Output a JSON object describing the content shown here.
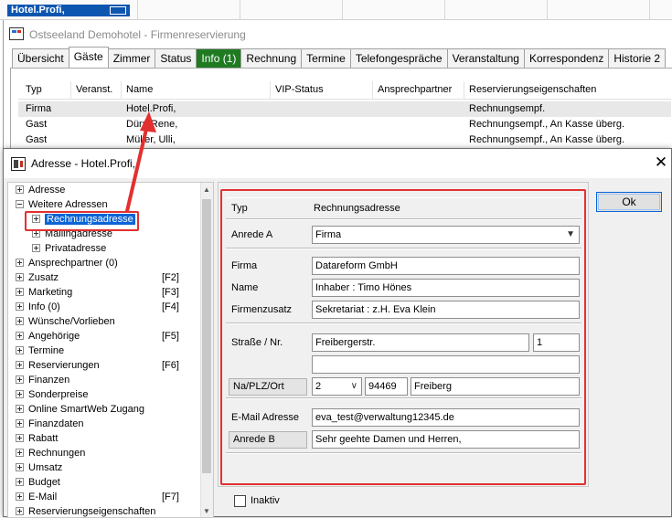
{
  "top_strip": {
    "cell_text": "Hotel.Profi,"
  },
  "back_window": {
    "title": "Ostseeland Demohotel - Firmenreservierung",
    "tabs": [
      "Übersicht",
      "Gäste",
      "Zimmer",
      "Status",
      "Info (1)",
      "Rechnung",
      "Termine",
      "Telefongespräche",
      "Veranstaltung",
      "Korrespondenz",
      "Historie 2"
    ],
    "active_tab": "Gäste",
    "columns": [
      "Typ",
      "Veranst.",
      "Name",
      "VIP-Status",
      "Ansprechpartner",
      "Reservierungseigenschaften"
    ],
    "rows": [
      {
        "typ": "Firma",
        "name": "Hotel.Profi,",
        "eigenschaften": "Rechnungsempf."
      },
      {
        "typ": "Gast",
        "name": "Dürr, Rene,",
        "eigenschaften": "Rechnungsempf., An Kasse überg."
      },
      {
        "typ": "Gast",
        "name": "Müller, Ulli,",
        "eigenschaften": "Rechnungsempf., An Kasse überg."
      }
    ]
  },
  "dialog": {
    "title": "Adresse - Hotel.Profi,",
    "close_glyph": "✕",
    "ok_label": "Ok",
    "tree": [
      {
        "label": "Adresse",
        "key": ""
      },
      {
        "label": "Weitere Adressen",
        "key": ""
      },
      {
        "label": "Rechnungsadresse",
        "key": ""
      },
      {
        "label": "Mailingadresse",
        "key": ""
      },
      {
        "label": "Privatadresse",
        "key": ""
      },
      {
        "label": "Ansprechpartner (0)",
        "key": ""
      },
      {
        "label": "Zusatz",
        "key": "[F2]"
      },
      {
        "label": "Marketing",
        "key": "[F3]"
      },
      {
        "label": "Info (0)",
        "key": "[F4]"
      },
      {
        "label": "Wünsche/Vorlieben",
        "key": ""
      },
      {
        "label": "Angehörige",
        "key": "[F5]"
      },
      {
        "label": "Termine",
        "key": ""
      },
      {
        "label": "Reservierungen",
        "key": "[F6]"
      },
      {
        "label": "Finanzen",
        "key": ""
      },
      {
        "label": "Sonderpreise",
        "key": ""
      },
      {
        "label": "Online SmartWeb Zugang",
        "key": ""
      },
      {
        "label": "Finanzdaten",
        "key": ""
      },
      {
        "label": "Rabatt",
        "key": ""
      },
      {
        "label": "Rechnungen",
        "key": ""
      },
      {
        "label": "Umsatz",
        "key": ""
      },
      {
        "label": "Budget",
        "key": ""
      },
      {
        "label": "E-Mail",
        "key": "[F7]"
      },
      {
        "label": "Reservierungseigenschaften",
        "key": ""
      }
    ],
    "selected_tree_item": "Rechnungsadresse",
    "form": {
      "typ_label": "Typ",
      "typ_value": "Rechnungsadresse",
      "anrede_a_label": "Anrede A",
      "anrede_a_value": "Firma",
      "firma_label": "Firma",
      "firma_value": "Datareform GmbH",
      "name_label": "Name",
      "name_value": "Inhaber : Timo Hönes",
      "firmenzusatz_label": "Firmenzusatz",
      "firmenzusatz_value": "Sekretariat : z.H. Eva Klein",
      "strasse_label": "Straße / Nr.",
      "strasse_value": "Freibergerstr.",
      "nr_value": "1",
      "strasse2_value": "",
      "na_plz_ort_label": "Na/PLZ/Ort",
      "nation_value": "2",
      "plz_value": "94469",
      "ort_value": "Freiberg",
      "email_label": "E-Mail Adresse",
      "email_value": "eva_test@verwaltung12345.de",
      "anrede_b_label": "Anrede B",
      "anrede_b_value": "Sehr geehte Damen und Herren,",
      "inaktiv_label": "Inaktiv"
    }
  },
  "colors": {
    "accent_red": "#e23030",
    "selection_blue": "#0a64d6",
    "info_tab_green": "#1f7a22",
    "top_cell_blue": "#0d56b0"
  },
  "icons": [
    "app-icon",
    "address-icon",
    "close-icon",
    "tree-expand-icon",
    "dropdown-caret-icon",
    "checkbox-icon"
  ]
}
